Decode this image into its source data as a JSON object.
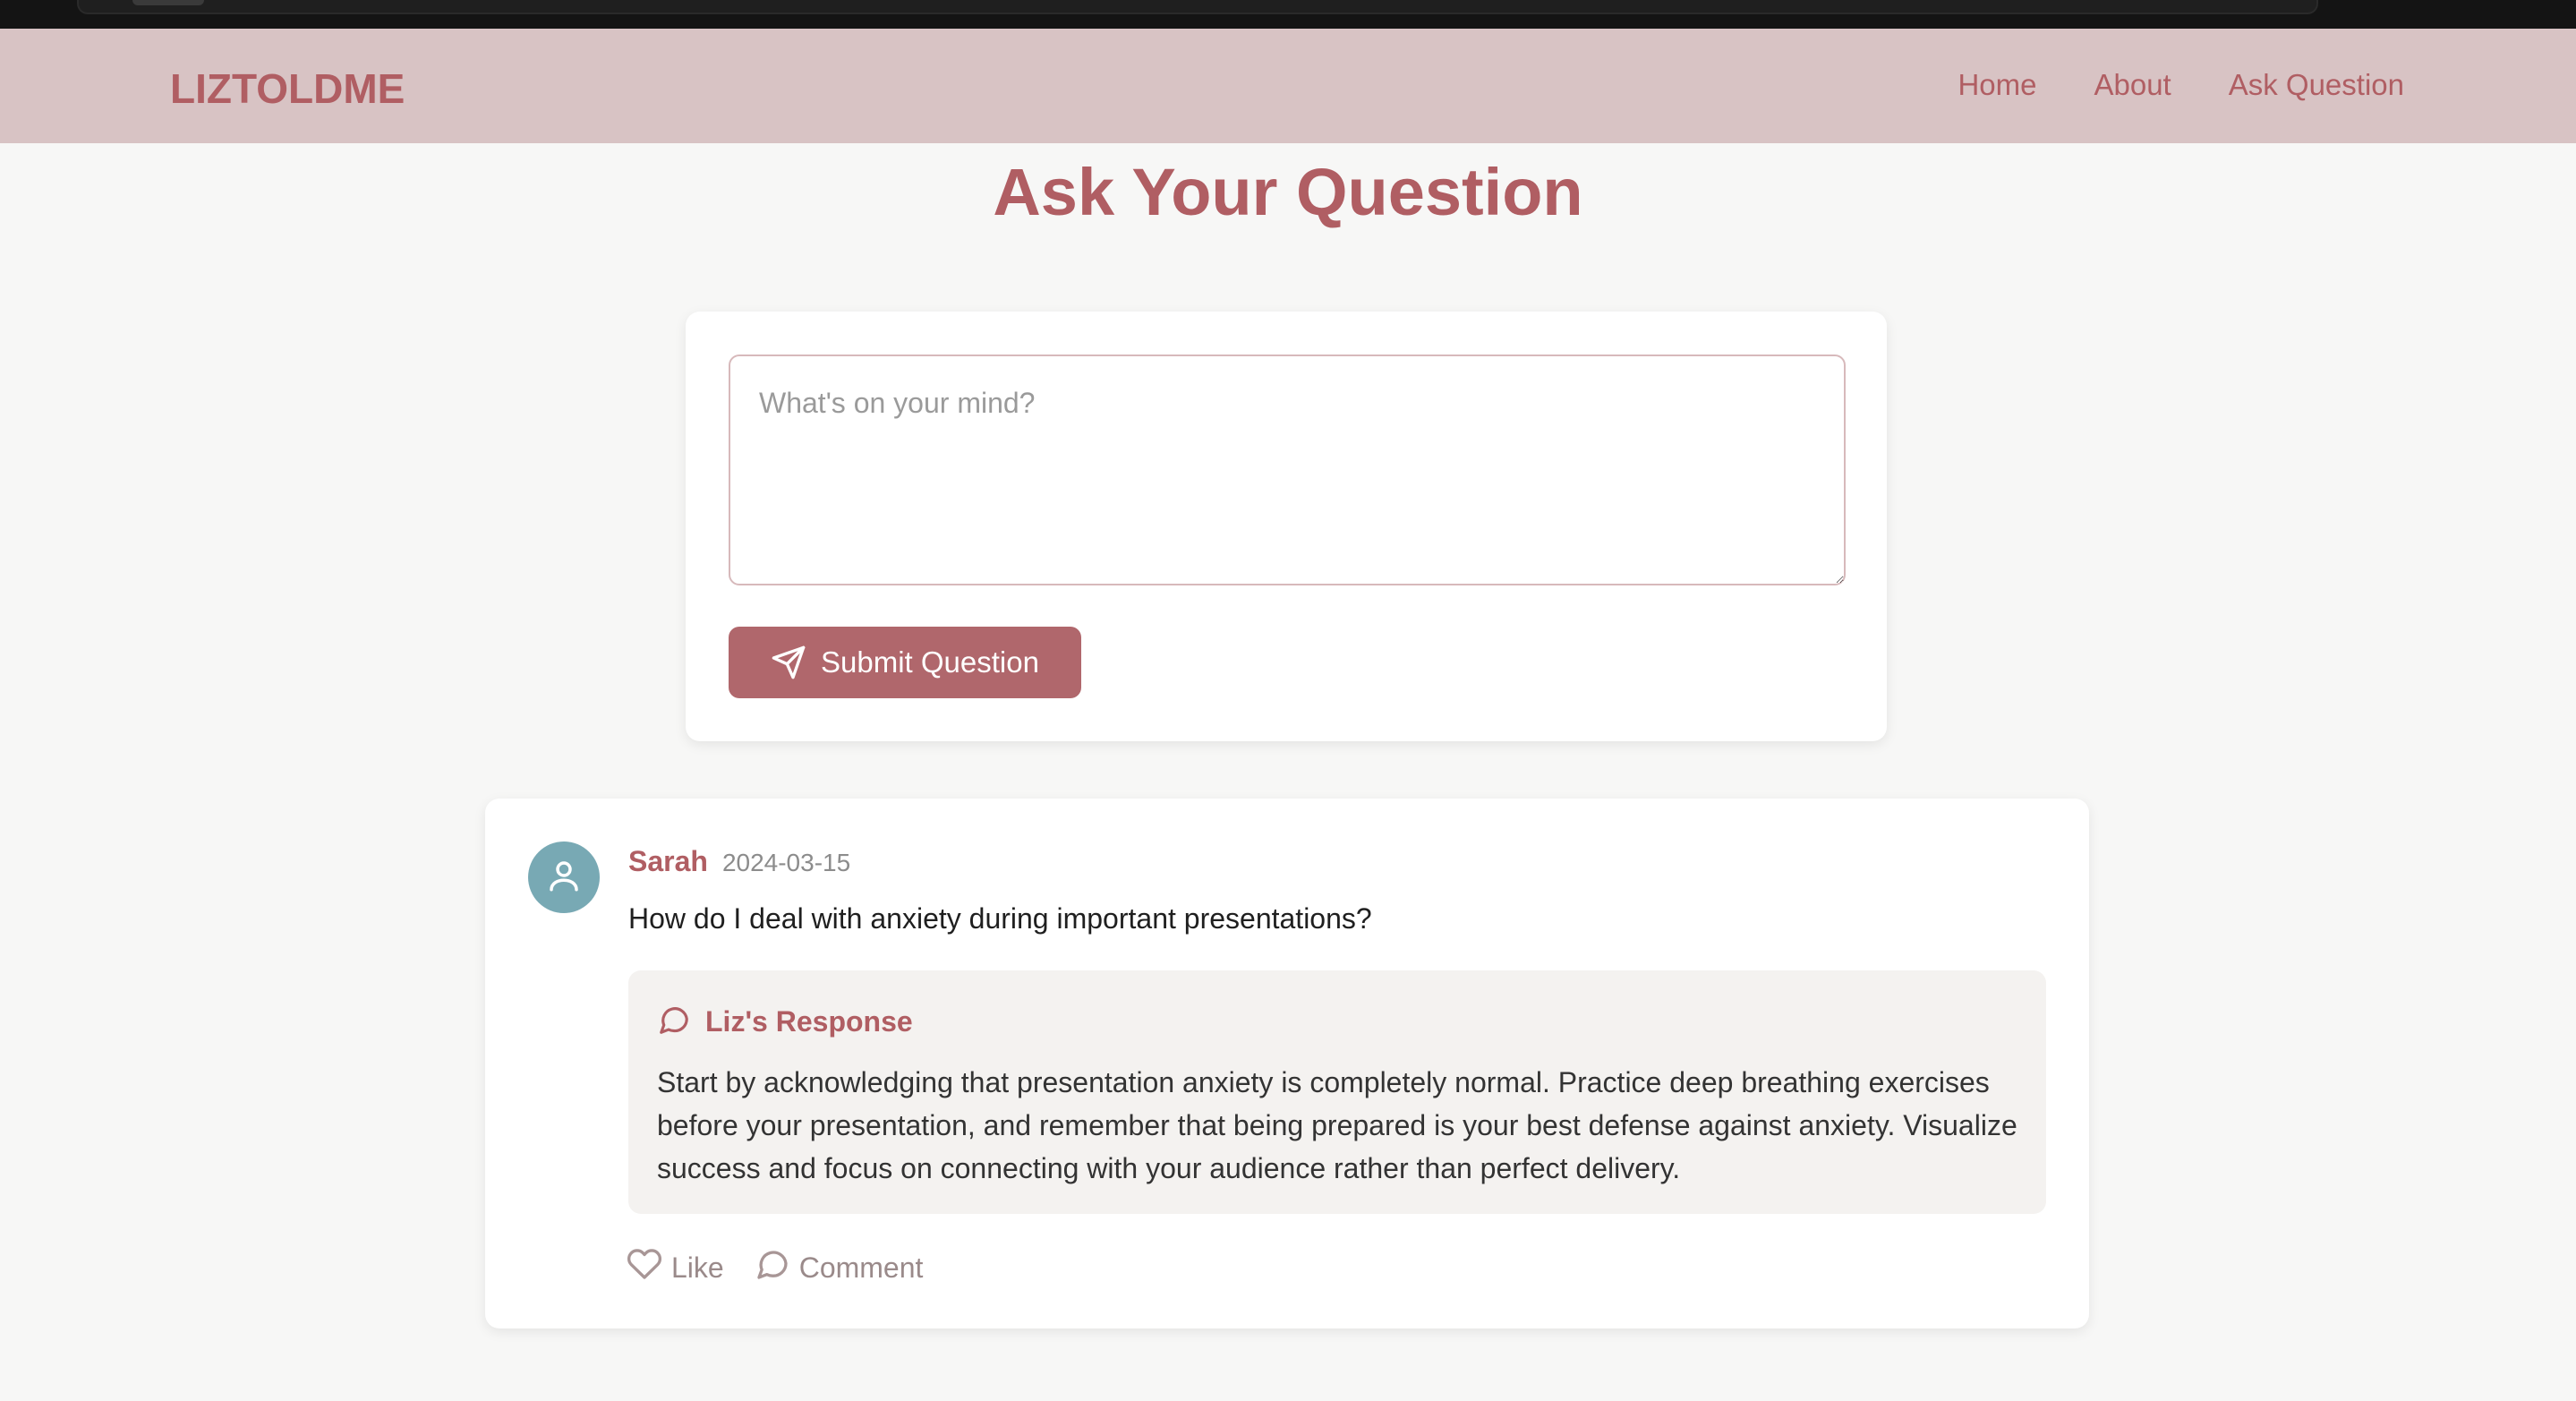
{
  "header": {
    "logo": "LIZTOLDME",
    "nav": [
      {
        "label": "Home"
      },
      {
        "label": "About"
      },
      {
        "label": "Ask Question"
      }
    ]
  },
  "page": {
    "title": "Ask Your Question"
  },
  "ask_form": {
    "placeholder": "What's on your mind?",
    "value": "",
    "submit_label": "Submit Question",
    "submit_icon": "send-icon"
  },
  "posts": [
    {
      "author": "Sarah",
      "date": "2024-03-15",
      "avatar_icon": "user-icon",
      "question": "How do I deal with anxiety during important presentations?",
      "response": {
        "icon": "message-circle-icon",
        "title": "Liz's Response",
        "text": "Start by acknowledging that presentation anxiety is completely normal. Practice deep breathing exercises before your presentation, and remember that being prepared is your best defense against anxiety. Visualize success and focus on connecting with your audience rather than perfect delivery."
      },
      "actions": {
        "like_label": "Like",
        "like_icon": "heart-icon",
        "comment_label": "Comment",
        "comment_icon": "message-circle-icon"
      }
    }
  ],
  "colors": {
    "brand": "#b05e63",
    "header_bg": "#d8c3c4",
    "button_bg": "#b0676c",
    "avatar_bg": "#78a9b4",
    "page_bg": "#f7f7f6",
    "response_bg": "#f4f2f0"
  }
}
